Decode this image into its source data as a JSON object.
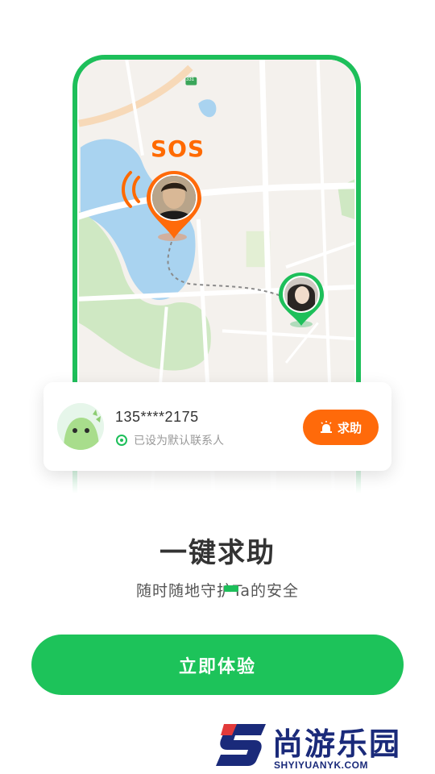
{
  "map": {
    "road_label": "331",
    "sos_label": "SOS"
  },
  "contact_card": {
    "phone": "135****2175",
    "status": "已设为默认联系人",
    "help_button": "求助"
  },
  "headline": {
    "title": "一键求助",
    "subtitle": "随时随地守护Ta的安全"
  },
  "cta": {
    "label": "立即体验"
  },
  "watermark": {
    "brand": "尚游乐园",
    "url": "SHYIYUANYK.COM"
  },
  "colors": {
    "accent_green": "#1dbf5a",
    "sos_orange": "#ff6a0a",
    "brand_navy": "#1a2a7a"
  }
}
